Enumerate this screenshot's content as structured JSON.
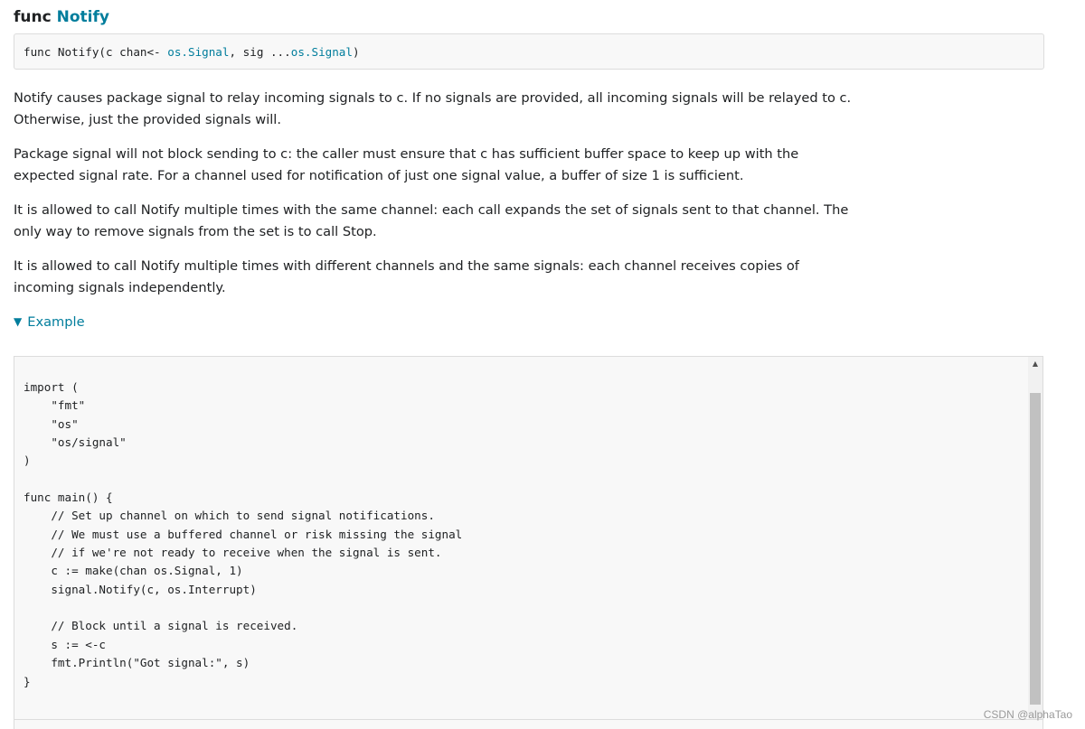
{
  "heading": {
    "prefix": "func",
    "name": "Notify"
  },
  "signature": {
    "part1": "func Notify(c chan<- ",
    "type1": "os.Signal",
    "part2": ", sig ...",
    "type2": "os.Signal",
    "part3": ")"
  },
  "paragraphs": [
    "Notify causes package signal to relay incoming signals to c. If no signals are provided, all incoming signals will be relayed to c. Otherwise, just the provided signals will.",
    "Package signal will not block sending to c: the caller must ensure that c has sufficient buffer space to keep up with the expected signal rate. For a channel used for notification of just one signal value, a buffer of size 1 is sufficient.",
    "It is allowed to call Notify multiple times with the same channel: each call expands the set of signals sent to that channel. The only way to remove signals from the set is to call Stop.",
    "It is allowed to call Notify multiple times with different channels and the same signals: each channel receives copies of incoming signals independently."
  ],
  "example": {
    "toggle_icon": "▼",
    "label": "Example",
    "code": "import (\n    \"fmt\"\n    \"os\"\n    \"os/signal\"\n)\n\nfunc main() {\n    // Set up channel on which to send signal notifications.\n    // We must use a buffered channel or risk missing the signal\n    // if we're not ready to receive when the signal is sent.\n    c := make(chan os.Signal, 1)\n    signal.Notify(c, os.Interrupt)\n\n    // Block until a signal is received.\n    s := <-c\n    fmt.Println(\"Got signal:\", s)\n}"
  },
  "scrollbar": {
    "up_icon": "▲"
  },
  "watermark": "CSDN @alphaTao"
}
